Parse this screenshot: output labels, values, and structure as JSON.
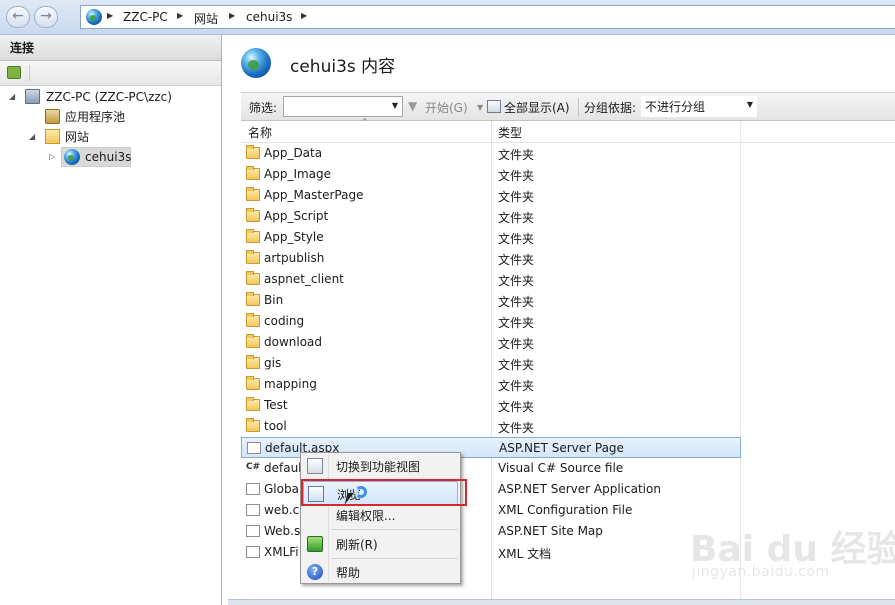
{
  "address_bar": {
    "crumbs": [
      "ZZC-PC",
      "网站",
      "cehui3s"
    ],
    "back_glyph": "←",
    "forward_glyph": "→"
  },
  "connections": {
    "title": "连接",
    "tree": [
      {
        "label": "ZZC-PC (ZZC-PC\\zzc)",
        "icon": "server-icon"
      },
      {
        "label": "应用程序池",
        "icon": "app-pool-icon"
      },
      {
        "label": "网站",
        "icon": "sites-folder-icon"
      },
      {
        "label": "cehui3s",
        "icon": "globe-icon",
        "selected": true
      }
    ]
  },
  "content": {
    "title": "cehui3s 内容",
    "filter_label": "筛选:",
    "filter_value": "",
    "start_label": "开始(G)",
    "show_all_label": "全部显示(A)",
    "group_by_label": "分组依据:",
    "group_by_value": "不进行分组",
    "col_name": "名称",
    "col_type": "类型",
    "rows": [
      {
        "name": "App_Data",
        "type": "文件夹",
        "icon": "folder-icon"
      },
      {
        "name": "App_Image",
        "type": "文件夹",
        "icon": "folder-icon"
      },
      {
        "name": "App_MasterPage",
        "type": "文件夹",
        "icon": "folder-icon"
      },
      {
        "name": "App_Script",
        "type": "文件夹",
        "icon": "folder-icon"
      },
      {
        "name": "App_Style",
        "type": "文件夹",
        "icon": "folder-icon"
      },
      {
        "name": "artpublish",
        "type": "文件夹",
        "icon": "folder-icon"
      },
      {
        "name": "aspnet_client",
        "type": "文件夹",
        "icon": "folder-icon"
      },
      {
        "name": "Bin",
        "type": "文件夹",
        "icon": "folder-icon"
      },
      {
        "name": "coding",
        "type": "文件夹",
        "icon": "folder-icon"
      },
      {
        "name": "download",
        "type": "文件夹",
        "icon": "folder-icon"
      },
      {
        "name": "gis",
        "type": "文件夹",
        "icon": "folder-icon"
      },
      {
        "name": "mapping",
        "type": "文件夹",
        "icon": "folder-icon"
      },
      {
        "name": "Test",
        "type": "文件夹",
        "icon": "folder-icon"
      },
      {
        "name": "tool",
        "type": "文件夹",
        "icon": "folder-icon"
      },
      {
        "name": "default.aspx",
        "type": "ASP.NET Server Page",
        "icon": "aspx-file-icon",
        "selected": true
      },
      {
        "name": "defaul",
        "type": "Visual C# Source file",
        "icon": "csharp-file-icon"
      },
      {
        "name": "Globa",
        "type": "ASP.NET Server Application",
        "icon": "asax-file-icon"
      },
      {
        "name": "web.co",
        "type": "XML Configuration File",
        "icon": "config-file-icon"
      },
      {
        "name": "Web.s",
        "type": "ASP.NET Site Map",
        "icon": "sitemap-file-icon"
      },
      {
        "name": "XMLFi",
        "type": "XML 文档",
        "icon": "xml-file-icon"
      }
    ]
  },
  "context_menu": {
    "items": [
      {
        "label": "切换到功能视图",
        "icon": "feature-view-icon"
      },
      {
        "label": "浏览",
        "icon": "browse-icon",
        "highlighted": true
      },
      {
        "label": "编辑权限...",
        "icon": ""
      },
      {
        "label": "刷新(R)",
        "icon": "refresh-icon"
      },
      {
        "label": "帮助",
        "icon": "help-icon"
      }
    ]
  },
  "watermark": {
    "brand": "Bai du 经验",
    "url": "jingyan.baidu.com"
  },
  "colors": {
    "selection_bg": "#d3e6f9",
    "selection_border": "#84acd8",
    "highlight_box": "#d9262b",
    "folder": "#f2c75c"
  }
}
